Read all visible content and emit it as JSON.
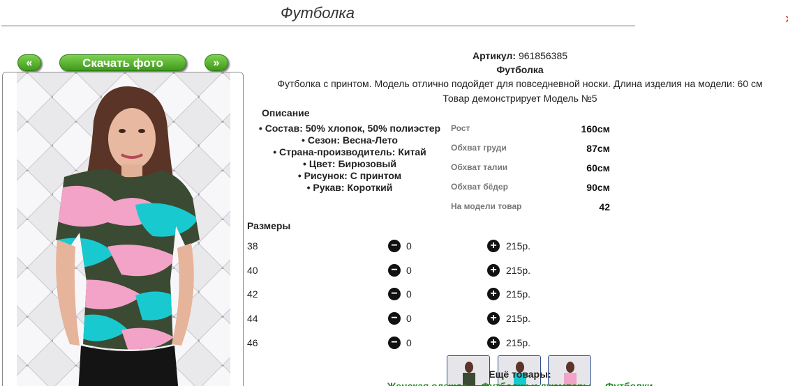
{
  "page": {
    "title": "Футболка"
  },
  "nav": {
    "prev": "«",
    "download": "Скачать фото",
    "next": "»"
  },
  "product": {
    "article_label": "Артикул:",
    "article_value": "961856385",
    "name": "Футболка",
    "description": "Футболка с принтом. Модель отлично подойдет для повседневной носки. Длина изделия на модели: 60 см",
    "model_line": "Товар демонстрирует Модель №5"
  },
  "description_block": {
    "heading": "Описание",
    "items": [
      "Состав: 50% хлопок, 50% полиэстер",
      "Сезон: Весна-Лето",
      "Страна-производитель: Китай",
      "Цвет: Бирюзовый",
      "Рисунок: С принтом",
      "Рукав: Короткий"
    ]
  },
  "measurements": [
    {
      "label": "Рост",
      "value": "160см"
    },
    {
      "label": "Обхват груди",
      "value": "87см"
    },
    {
      "label": "Обхват талии",
      "value": "60см"
    },
    {
      "label": "Обхват бёдер",
      "value": "90см"
    },
    {
      "label": "На модели товар",
      "value": "42"
    }
  ],
  "sizes": {
    "heading": "Размеры",
    "rows": [
      {
        "size": "38",
        "qty": "0",
        "price": "215р."
      },
      {
        "size": "40",
        "qty": "0",
        "price": "215р."
      },
      {
        "size": "42",
        "qty": "0",
        "price": "215р."
      },
      {
        "size": "44",
        "qty": "0",
        "price": "215р."
      },
      {
        "size": "46",
        "qty": "0",
        "price": "215р."
      }
    ]
  },
  "more": {
    "heading": "Ещё товары:",
    "links": [
      "Женская одежда",
      "Футболки и джемперы",
      "Футболки"
    ]
  },
  "icons": {
    "minus": "minus-circle-icon",
    "plus": "plus-circle-icon"
  },
  "colors": {
    "accent_green": "#4caf28",
    "link_green": "#1d8a1d",
    "camo_turquoise": "#19c9d0",
    "camo_pink": "#f2a3c7",
    "camo_dark": "#3b4a32"
  }
}
